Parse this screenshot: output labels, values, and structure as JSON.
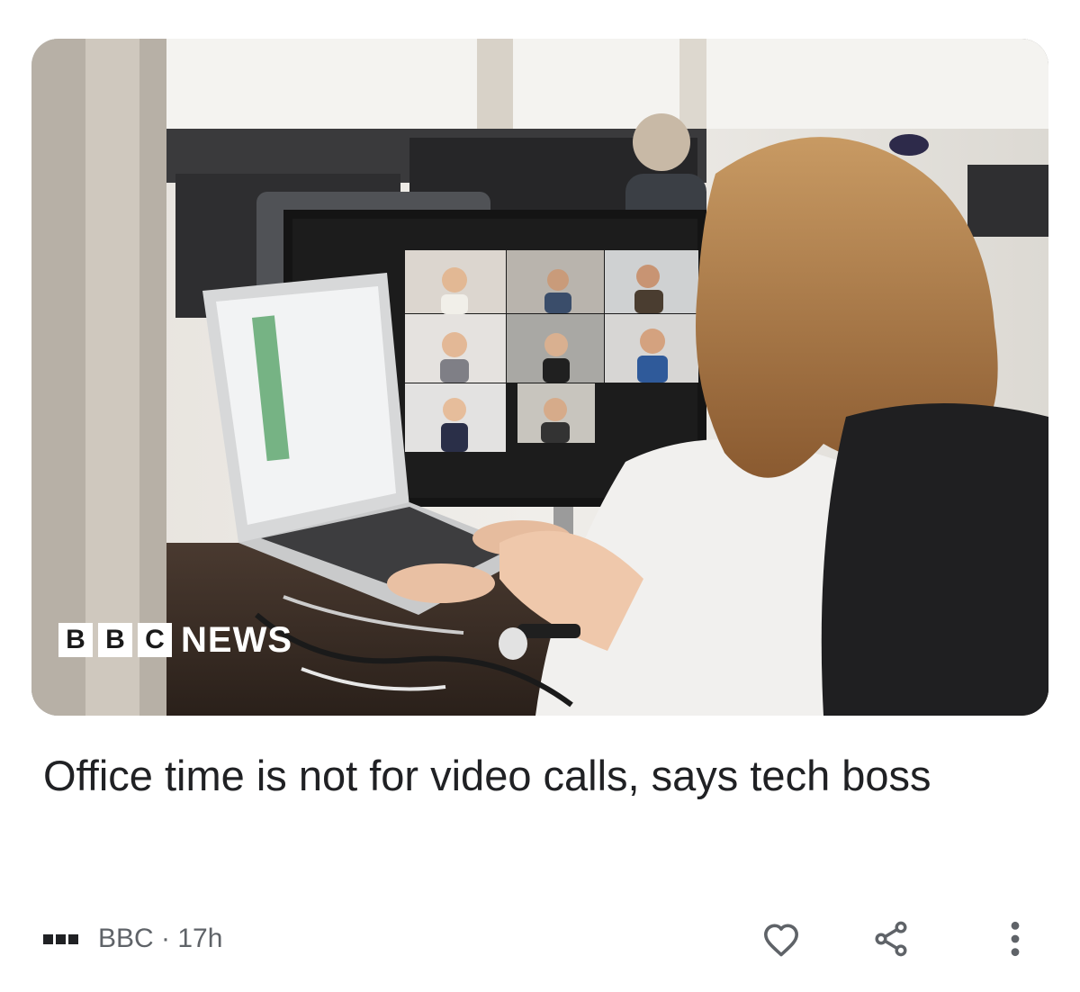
{
  "article": {
    "image": {
      "alt_description": "",
      "logo": {
        "blocks": [
          "B",
          "B",
          "C"
        ],
        "wordmark": "NEWS"
      }
    },
    "headline": "Office time is not for video calls, says tech boss",
    "source": {
      "name": "BBC",
      "separator": "·",
      "age": "17h",
      "logo_icon": "bbc-blocks-icon"
    },
    "actions": {
      "like_icon": "heart-outline-icon",
      "share_icon": "share-icon",
      "more_icon": "more-vertical-icon"
    }
  },
  "colors": {
    "text_primary": "#202124",
    "text_secondary": "#5f6368",
    "icon": "#5f6368"
  }
}
